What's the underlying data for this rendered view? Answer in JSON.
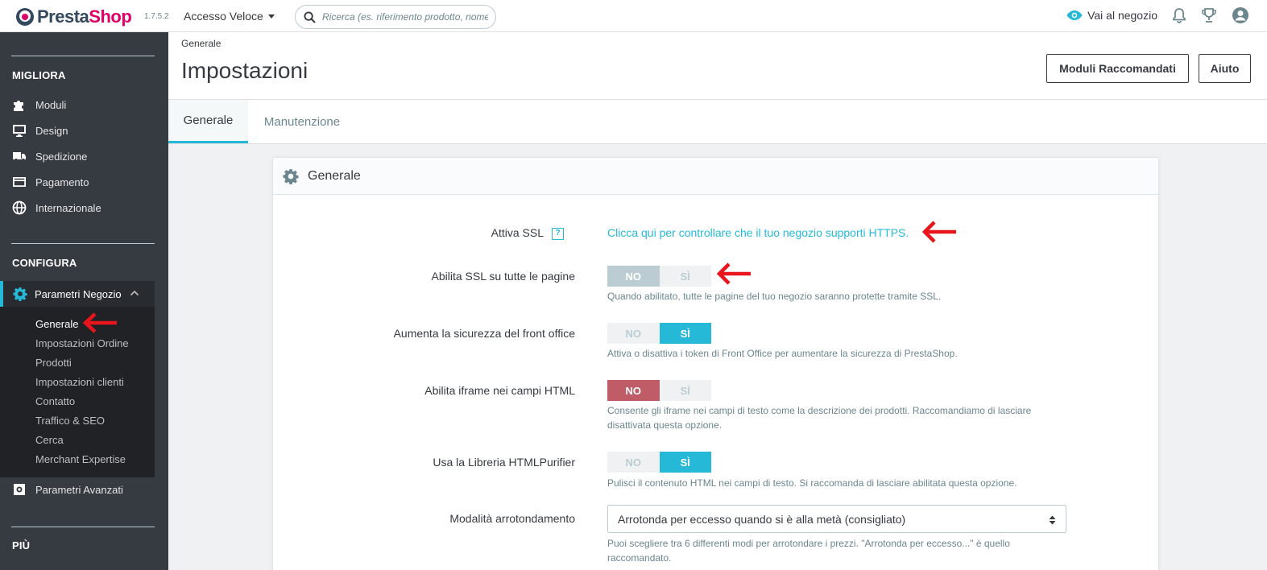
{
  "header": {
    "logo_prefix": "Presta",
    "logo_suffix": "Shop",
    "version": "1.7.5.2",
    "quick_access": "Accesso Veloce",
    "search_placeholder": "Ricerca (es. riferimento prodotto, nome",
    "view_shop": "Vai al negozio"
  },
  "sidebar": {
    "section_improve": "MIGLIORA",
    "improve_items": [
      "Moduli",
      "Design",
      "Spedizione",
      "Pagamento",
      "Internazionale"
    ],
    "section_configure": "CONFIGURA",
    "shop_params": "Parametri Negozio",
    "sub_items": [
      "Generale",
      "Impostazioni Ordine",
      "Prodotti",
      "Impostazioni clienti",
      "Contatto",
      "Traffico & SEO",
      "Cerca",
      "Merchant Expertise"
    ],
    "advanced_params": "Parametri Avanzati",
    "section_more": "PIÙ"
  },
  "page": {
    "breadcrumb": "Generale",
    "title": "Impostazioni",
    "btn_modules": "Moduli Raccomandati",
    "btn_help": "Aiuto"
  },
  "tabs": [
    "Generale",
    "Manutenzione"
  ],
  "panel": {
    "title": "Generale",
    "rows": {
      "ssl_label": "Attiva SSL",
      "ssl_help_q": "?",
      "ssl_link": "Clicca qui per controllare che il tuo negozio supporti HTTPS.",
      "ssl_all_label": "Abilita SSL su tutte le pagine",
      "ssl_all_help": "Quando abilitato, tutte le pagine del tuo negozio saranno protette tramite SSL.",
      "front_sec_label": "Aumenta la sicurezza del front office",
      "front_sec_help": "Attiva o disattiva i token di Front Office per aumentare la sicurezza di PrestaShop.",
      "iframe_label": "Abilita iframe nei campi HTML",
      "iframe_help_1": "Consente gli iframe nei campi di testo come la descrizione dei prodotti. Raccomandiamo di lasciare",
      "iframe_help_2": "disattivata questa opzione.",
      "purifier_label": "Usa la Libreria HTMLPurifier",
      "purifier_help": "Pulisci il contenuto HTML nei campi di testo. Si raccomanda di lasciare abilitata questa opzione.",
      "rounding_label": "Modalità arrotondamento",
      "rounding_value": "Arrotonda per eccesso quando si è alla metà (consigliato)",
      "rounding_help_1": "Puoi scegliere tra 6 differenti modi per arrotondare i prezzi. \"Arrotonda per eccesso...\" è quello",
      "rounding_help_2": "raccomandato."
    },
    "switch_no": "NO",
    "switch_yes": "SÌ"
  },
  "colors": {
    "accent": "#25b9d7",
    "brand": "#df0067",
    "sidebar": "#363a41",
    "danger": "#c05c67",
    "arrow": "#e8151c"
  }
}
